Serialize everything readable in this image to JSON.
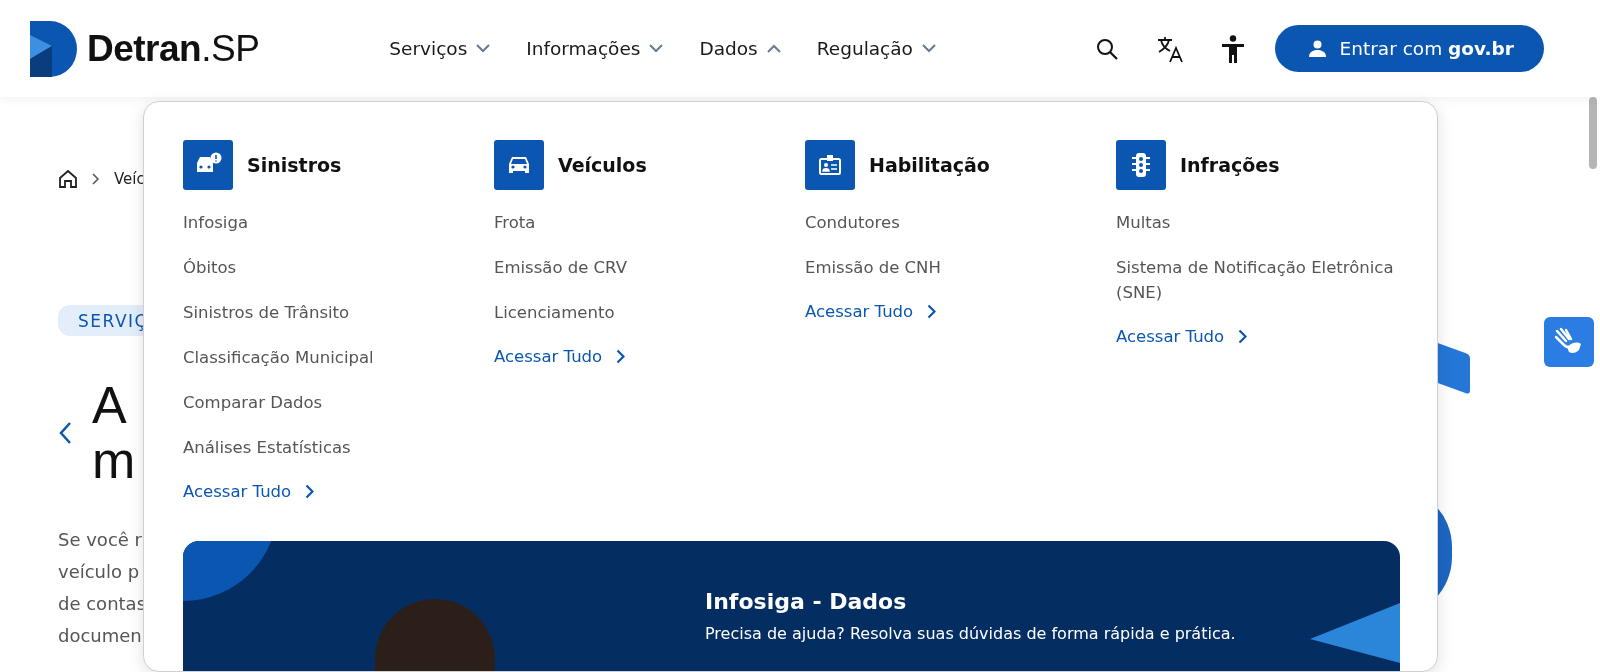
{
  "header": {
    "logo": {
      "name": "Detran",
      "suffix": ".SP"
    },
    "nav": [
      {
        "label": "Serviços",
        "expanded": false
      },
      {
        "label": "Informações",
        "expanded": false
      },
      {
        "label": "Dados",
        "expanded": true
      },
      {
        "label": "Regulação",
        "expanded": false
      }
    ],
    "login_button": "Entrar com **gov.br**"
  },
  "background_page": {
    "breadcrumb": "Veíc",
    "tag": "SERVIÇ",
    "heading_lines": [
      "A",
      "m"
    ],
    "paragraph_lines": [
      "Se você r",
      "veículo p",
      "de contas",
      "documen"
    ]
  },
  "mega_menu": {
    "columns": [
      {
        "title": "Sinistros",
        "kind": "crash",
        "links": [
          "Infosiga",
          "Óbitos",
          "Sinistros de Trânsito",
          "Classificação Municipal",
          "Comparar Dados",
          "Análises Estatísticas"
        ],
        "more": "Acessar Tudo"
      },
      {
        "title": "Veículos",
        "kind": "car",
        "links": [
          "Frota",
          "Emissão de CRV",
          "Licenciamento"
        ],
        "more": "Acessar Tudo"
      },
      {
        "title": "Habilitação",
        "kind": "license",
        "links": [
          "Condutores",
          "Emissão de CNH"
        ],
        "more": "Acessar Tudo"
      },
      {
        "title": "Infrações",
        "kind": "traffic-light",
        "links": [
          "Multas",
          "Sistema de Notificação Eletrônica (SNE)"
        ],
        "more": "Acessar Tudo"
      }
    ],
    "banner": {
      "title": "Infosiga - Dados",
      "text": "Precisa de ajuda? Resolva suas dúvidas de forma rápida e prática."
    }
  }
}
